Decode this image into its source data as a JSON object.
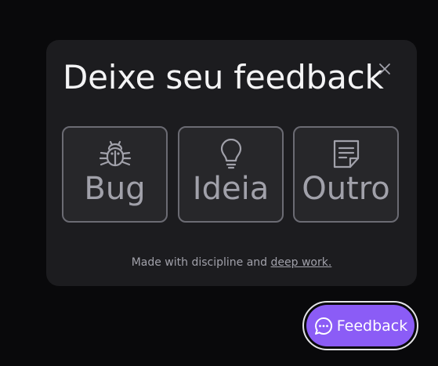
{
  "popup": {
    "title": "Deixe seu feedback",
    "close_icon": "close-icon",
    "options": [
      {
        "label": "Bug",
        "icon": "bug-icon"
      },
      {
        "label": "Ideia",
        "icon": "lightbulb-icon"
      },
      {
        "label": "Outro",
        "icon": "note-icon"
      }
    ],
    "footer_text": "Made with discipline and ",
    "footer_link": "deep work."
  },
  "fab": {
    "label": "Feedback",
    "icon": "chat-bubble-icon",
    "color": "#8b5cf6"
  },
  "colors": {
    "background": "#09090b",
    "panel": "#1c1c1f",
    "option_border": "#6b6b73",
    "text_muted": "#a1a1aa"
  }
}
